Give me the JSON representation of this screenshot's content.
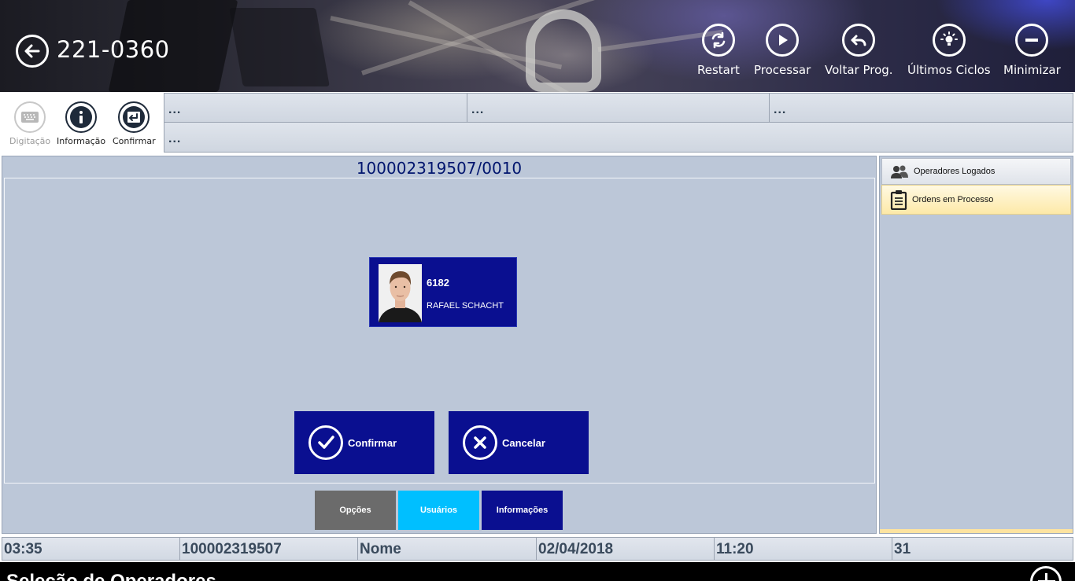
{
  "header": {
    "title": "221-0360",
    "actions": [
      {
        "label": "Restart",
        "icon": "restart-icon"
      },
      {
        "label": "Processar",
        "icon": "play-icon"
      },
      {
        "label": "Voltar Prog.",
        "icon": "undo-icon"
      },
      {
        "label": "Últimos Ciclos",
        "icon": "lightbulb-icon"
      },
      {
        "label": "Minimizar",
        "icon": "minus-icon"
      }
    ]
  },
  "toolbar": {
    "digitacao_label": "Digitação",
    "informacao_label": "Informação",
    "confirmar_label": "Confirmar"
  },
  "info_grid": {
    "row1": [
      "...",
      "...",
      "..."
    ],
    "row2": "..."
  },
  "main": {
    "order_code": "100002319507/0010",
    "operator": {
      "id": "6182",
      "name": "RAFAEL SCHACHT"
    },
    "confirm_label": "Confirmar",
    "cancel_label": "Cancelar",
    "tabs": [
      {
        "label": "Opções",
        "color": "#6b6b6b"
      },
      {
        "label": "Usuários",
        "color": "#00bfff"
      },
      {
        "label": "Informações",
        "color": "#0a0f90"
      }
    ]
  },
  "right_panel": {
    "items": [
      {
        "label": "Operadores Logados",
        "icon": "users-icon"
      },
      {
        "label": "Ordens em Processo",
        "icon": "clipboard-icon"
      }
    ]
  },
  "status_bar": {
    "cells": [
      "03:35",
      "100002319507",
      "Nome",
      "02/04/2018",
      "11:20",
      "31"
    ]
  },
  "bottom_bar": {
    "title": "Seleção de Operadores"
  },
  "colors": {
    "accent_blue": "#0a0f90",
    "panel_bg": "#bcc7d8",
    "tab_active": "#00bfff"
  }
}
